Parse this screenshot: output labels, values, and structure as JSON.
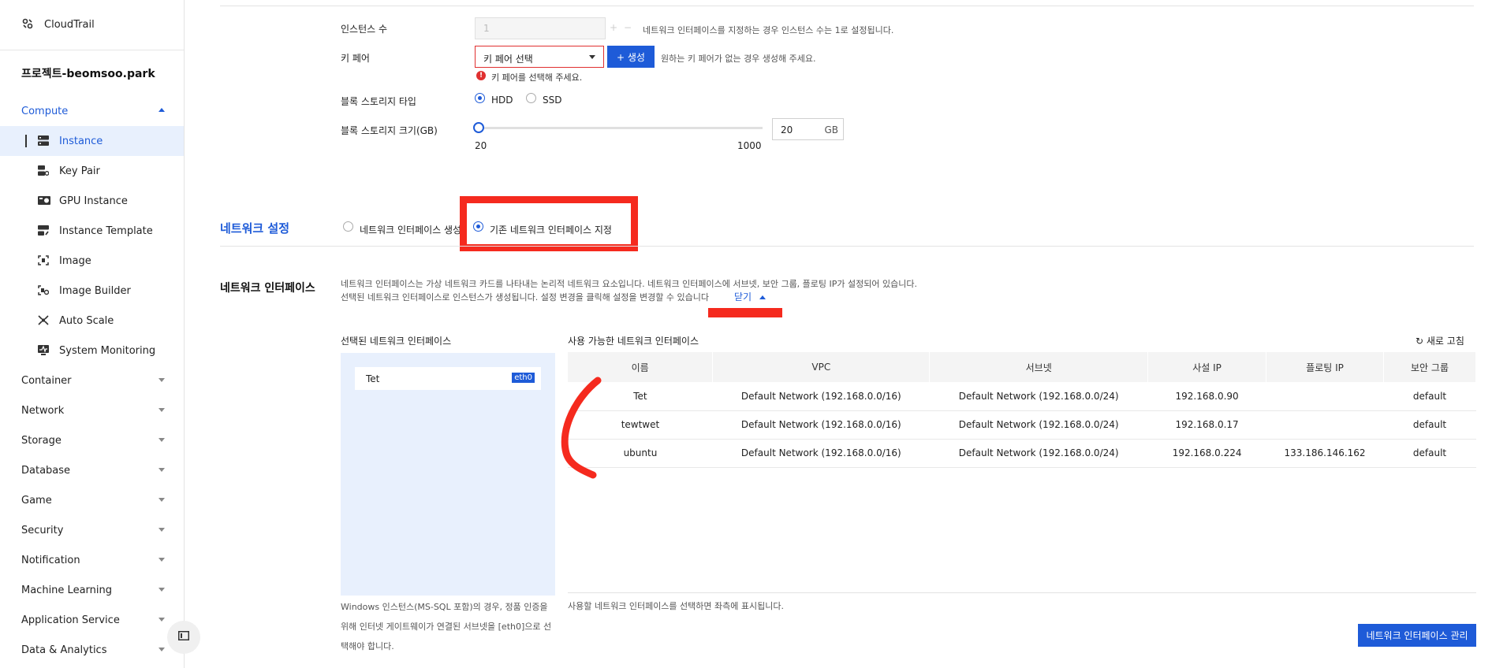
{
  "sidebar": {
    "app_name": "CloudTrail",
    "project": "프로젝트-beomsoo.park",
    "compute_label": "Compute",
    "compute_items": [
      {
        "label": "Instance",
        "icon": "server-icon"
      },
      {
        "label": "Key Pair",
        "icon": "key-pair-icon"
      },
      {
        "label": "GPU Instance",
        "icon": "gpu-icon"
      },
      {
        "label": "Instance Template",
        "icon": "template-icon"
      },
      {
        "label": "Image",
        "icon": "image-icon"
      },
      {
        "label": "Image Builder",
        "icon": "image-builder-icon"
      },
      {
        "label": "Auto Scale",
        "icon": "auto-scale-icon"
      },
      {
        "label": "System Monitoring",
        "icon": "monitoring-icon"
      }
    ],
    "categories": [
      "Container",
      "Network",
      "Storage",
      "Database",
      "Game",
      "Security",
      "Notification",
      "Machine Learning",
      "Application Service",
      "Data & Analytics"
    ],
    "collapse_icon": "panel-toggle-icon"
  },
  "form": {
    "instance_count_label": "인스턴스 수",
    "instance_count_value": "1",
    "instance_count_help": "네트워크 인터페이스를 지정하는 경우 인스턴스 수는 1로 설정됩니다.",
    "key_pair_label": "키 페어",
    "key_pair_select": "키 페어 선택",
    "key_pair_create": "+ 생성",
    "key_pair_help": "원하는 키 페어가 없는 경우 생성해 주세요.",
    "key_pair_error": "키 페어를 선택해 주세요.",
    "storage_type_label": "블록 스토리지 타입",
    "storage_type_options": [
      "HDD",
      "SSD"
    ],
    "storage_type_selected": "HDD",
    "storage_size_label": "블록 스토리지 크기(GB)",
    "storage_size_min": "20",
    "storage_size_max": "1000",
    "storage_size_value": "20",
    "storage_size_unit": "GB",
    "storage_size_fraction": 0.0
  },
  "network_settings": {
    "title": "네트워크 설정",
    "option_create": "네트워크 인터페이스 생성",
    "option_existing": "기존 네트워크 인터페이스 지정",
    "selected": "기존 네트워크 인터페이스 지정"
  },
  "network_interface": {
    "title": "네트워크 인터페이스",
    "desc_line1": "네트워크 인터페이스는 가상 네트워크 카드를 나타내는 논리적 네트워크 요소입니다. 네트워크 인터페이스에 서브넷, 보안 그룹, 플로팅 IP가 설정되어 있습니다.",
    "desc_line2": "선택된 네트워크 인터페이스로 인스턴스가 생성됩니다. 설정 변경을 클릭해 설정을 변경할 수 있습니다",
    "close_link": "닫기",
    "selected_title": "선택된 네트워크 인터페이스",
    "selected_items": [
      {
        "name": "Tet",
        "badge": "eth0"
      }
    ],
    "selected_note": "Windows 인스턴스(MS-SQL 포함)의 경우, 정품 인증을 위해 인터넷 게이트웨이가 연결된 서브넷을 [eth0]으로 선택해야 합니다.",
    "available_title": "사용 가능한 네트워크 인터페이스",
    "refresh_label": "새로 고침",
    "columns": [
      "이름",
      "VPC",
      "서브넷",
      "사설 IP",
      "플로팅 IP",
      "보안 그룹"
    ],
    "rows": [
      [
        "Tet",
        "Default Network (192.168.0.0/16)",
        "Default Network (192.168.0.0/24)",
        "192.168.0.90",
        "",
        "default"
      ],
      [
        "tewtwet",
        "Default Network (192.168.0.0/16)",
        "Default Network (192.168.0.0/24)",
        "192.168.0.17",
        "",
        "default"
      ],
      [
        "ubuntu",
        "Default Network (192.168.0.0/16)",
        "Default Network (192.168.0.0/24)",
        "192.168.0.224",
        "133.186.146.162",
        "default"
      ]
    ],
    "available_note": "사용할 네트워크 인터페이스를 선택하면 좌측에 표시됩니다.",
    "manage_button": "네트워크 인터페이스 관리"
  },
  "colors": {
    "accent": "#1e5bd8",
    "annotation_red": "#f52a1e",
    "panel_bg": "#e8f0fd"
  }
}
